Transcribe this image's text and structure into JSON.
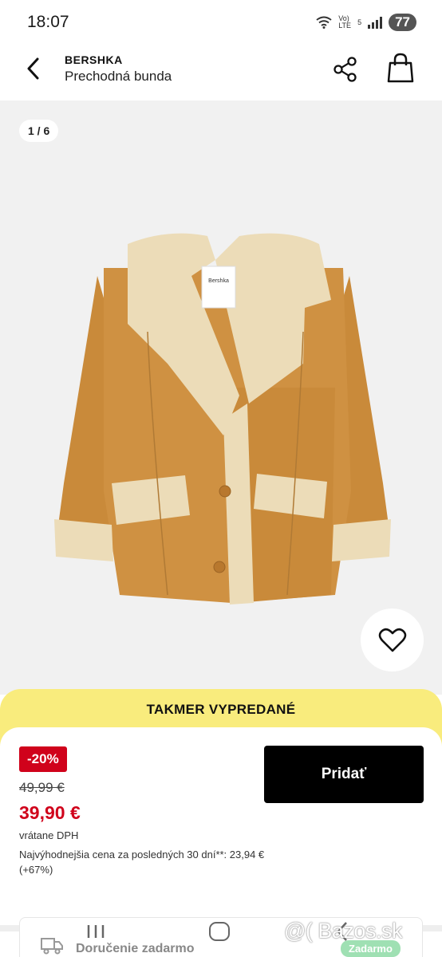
{
  "status_bar": {
    "time": "18:07",
    "network_top": "5",
    "network_label": "LTE",
    "volte": "Vo)",
    "battery": "77"
  },
  "header": {
    "brand": "BERSHKA",
    "product_name": "Prechodná bunda"
  },
  "gallery": {
    "counter": "1 / 6",
    "jacket_tag": "Bershka"
  },
  "stock_banner": "TAKMER VYPREDANÉ",
  "price": {
    "discount": "-20%",
    "old_price": "49,99 €",
    "new_price": "39,90 €",
    "vat_note": "vrátane DPH",
    "lowest_price_note": "Najvýhodnejšia cena za posledných 30 dní**: 23,94 € (+67%)"
  },
  "add_button_label": "Pridať",
  "delivery": {
    "text": "Doručenie zadarmo",
    "badge": "Zadarmo"
  },
  "watermark": "@( Bazos.sk",
  "colors": {
    "banner": "#f9ec7d",
    "sale_red": "#d0021b",
    "button": "#000000",
    "jacket": "#c98a3a",
    "shearling": "#ecdcb8"
  },
  "icons": [
    "back-arrow-icon",
    "share-icon",
    "shopping-bag-icon",
    "heart-icon",
    "truck-icon",
    "recent-apps-icon",
    "home-icon",
    "nav-back-icon"
  ]
}
